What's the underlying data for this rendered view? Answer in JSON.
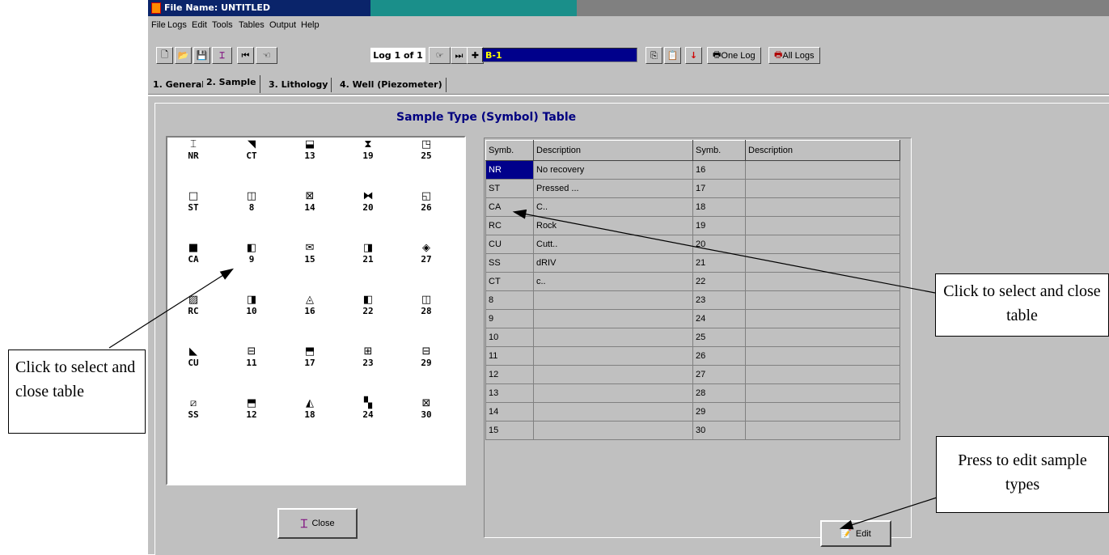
{
  "window": {
    "title": "File Name: UNTITLED"
  },
  "menu": [
    "File",
    "Logs",
    "Edit",
    "Tools",
    "Tables",
    "Output",
    "Help"
  ],
  "toolbar": {
    "log_counter": "Log 1 of 1",
    "log_name": "B-1",
    "one_log": "One Log",
    "all_logs": "All Logs"
  },
  "tabs": [
    "1. General",
    "2. Sample",
    "3. Lithology",
    "4. Well (Piezometer)"
  ],
  "active_tab": "2. Sample",
  "panel": {
    "heading": "Sample Type (Symbol) Table"
  },
  "symbols": [
    {
      "label": "NR",
      "icon": "i-beam-icon"
    },
    {
      "label": "CT",
      "icon": "half-diagonal-black-icon"
    },
    {
      "label": "13",
      "icon": "bottom-half-black-icon"
    },
    {
      "label": "19",
      "icon": "hourglass-icon"
    },
    {
      "label": "25",
      "icon": "corner-black-icon"
    },
    {
      "label": "ST",
      "icon": "empty-square-icon"
    },
    {
      "label": "8",
      "icon": "three-column-icon"
    },
    {
      "label": "14",
      "icon": "x-box-icon"
    },
    {
      "label": "20",
      "icon": "bowtie-icon"
    },
    {
      "label": "26",
      "icon": "bottom-left-corner-icon"
    },
    {
      "label": "CA",
      "icon": "solid-square-icon"
    },
    {
      "label": "9",
      "icon": "left-half-black-icon"
    },
    {
      "label": "15",
      "icon": "envelope-icon"
    },
    {
      "label": "21",
      "icon": "right-triangle-icon"
    },
    {
      "label": "27",
      "icon": "diamond-box-icon"
    },
    {
      "label": "RC",
      "icon": "slash-box-icon"
    },
    {
      "label": "10",
      "icon": "right-half-black-icon"
    },
    {
      "label": "16",
      "icon": "bottom-triangle-icon"
    },
    {
      "label": "22",
      "icon": "left-triangle-icon"
    },
    {
      "label": "28",
      "icon": "double-column-icon"
    },
    {
      "label": "CU",
      "icon": "lower-diagonal-black-icon"
    },
    {
      "label": "11",
      "icon": "horizontal-line-box-icon"
    },
    {
      "label": "17",
      "icon": "top-triangle-black-icon"
    },
    {
      "label": "23",
      "icon": "cross-box-icon"
    },
    {
      "label": "29",
      "icon": "horizontal-line-box-icon"
    },
    {
      "label": "SS",
      "icon": "backslash-box-icon"
    },
    {
      "label": "12",
      "icon": "top-half-black-icon"
    },
    {
      "label": "18",
      "icon": "mountain-icon"
    },
    {
      "label": "24",
      "icon": "checker-icon"
    },
    {
      "label": "30",
      "icon": "x-box-icon"
    }
  ],
  "table": {
    "headers": [
      "Symb.",
      "Description",
      "Symb.",
      "Description"
    ],
    "rows": [
      [
        "NR",
        "No recovery",
        "16",
        ""
      ],
      [
        "ST",
        "Pressed ...",
        "17",
        ""
      ],
      [
        "CA",
        "C..",
        "18",
        ""
      ],
      [
        "RC",
        "Rock",
        "19",
        ""
      ],
      [
        "CU",
        "Cutt..",
        "20",
        ""
      ],
      [
        "SS",
        "dRIV",
        "21",
        ""
      ],
      [
        "CT",
        "c..",
        "22",
        ""
      ],
      [
        "8",
        "",
        "23",
        ""
      ],
      [
        "9",
        "",
        "24",
        ""
      ],
      [
        "10",
        "",
        "25",
        ""
      ],
      [
        "11",
        "",
        "26",
        ""
      ],
      [
        "12",
        "",
        "27",
        ""
      ],
      [
        "13",
        "",
        "28",
        ""
      ],
      [
        "14",
        "",
        "29",
        ""
      ],
      [
        "15",
        "",
        "30",
        ""
      ]
    ],
    "selected_cell": "NR"
  },
  "buttons": {
    "close": "Close",
    "edit": "Edit"
  },
  "callouts": {
    "left": "Click to select and close table",
    "right": "Click to select and close table",
    "edit": "Press to edit sample types"
  }
}
